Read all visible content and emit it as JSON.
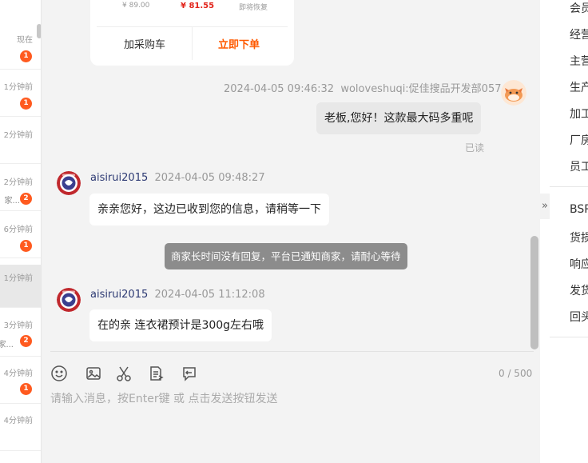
{
  "conversation_list": [
    {
      "time": "现在",
      "snippet": "",
      "badge": "1"
    },
    {
      "time": "1分钟前",
      "snippet": "",
      "badge": "1"
    },
    {
      "time": "2分钟前",
      "snippet": "",
      "badge": ""
    },
    {
      "time": "2分钟前",
      "snippet": "家...",
      "badge": "2"
    },
    {
      "time": "6分钟前",
      "snippet": "",
      "badge": "1"
    },
    {
      "time": "1分钟前",
      "snippet": "",
      "badge": ""
    },
    {
      "time": "3分钟前",
      "snippet": "家...",
      "badge": "2"
    },
    {
      "time": "4分钟前",
      "snippet": "",
      "badge": "1"
    },
    {
      "time": "4分钟前",
      "snippet": "",
      "badge": ""
    }
  ],
  "product_card": {
    "original_price": "¥ 89.00",
    "sale_price": "¥ 81.55",
    "status_note": "即将恢复",
    "add_to_cart": "加采购车",
    "buy_now": "立即下单"
  },
  "messages": [
    {
      "sender": "woloveshuqi:促佳搜品开发部057",
      "time": "2024-04-05 09:46:32",
      "text": "老板,您好！这款最大码多重呢",
      "read_status": "已读"
    },
    {
      "sender": "aisirui2015",
      "time": "2024-04-05 09:48:27",
      "text": "亲亲您好，这边已收到您的信息，请稍等一下"
    },
    {
      "system_notice": "商家长时间没有回复，平台已通知商家，请耐心等待"
    },
    {
      "sender": "aisirui2015",
      "time": "2024-04-05 11:12:08",
      "text": "在的亲 连衣裙预计是300g左右哦"
    }
  ],
  "composer": {
    "char_count": "0 / 500",
    "placeholder": "请输入消息，按Enter键 或 点击发送按钮发送"
  },
  "right_panel": {
    "menu_group_1": [
      "会员",
      "经营",
      "主营",
      "生产",
      "加工",
      "厂房",
      "员工"
    ],
    "menu_group_2": [
      "BSR",
      "货损",
      "响应",
      "发货",
      "回头"
    ]
  },
  "colors": {
    "accent": "#ff5a1f",
    "sender_name": "#2d3a73",
    "buy_now": "#ff5a00"
  }
}
